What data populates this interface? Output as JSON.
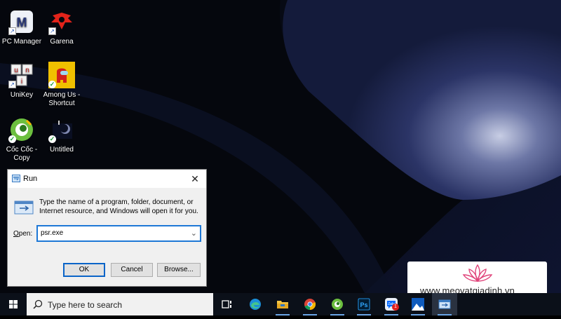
{
  "desktop": {
    "icons": [
      {
        "label": "PC Manager",
        "icon": "pc-manager-icon"
      },
      {
        "label": "Garena",
        "icon": "garena-icon"
      },
      {
        "label": "UniKey",
        "icon": "unikey-icon"
      },
      {
        "label": "Among Us - Shortcut",
        "icon": "among-us-icon"
      },
      {
        "label": "Cốc Cốc - Copy",
        "icon": "coccoc-icon"
      },
      {
        "label": "Untitled",
        "icon": "untitled-image-icon"
      }
    ]
  },
  "run_dialog": {
    "title": "Run",
    "description": "Type the name of a program, folder, document, or Internet resource, and Windows will open it for you.",
    "open_label": "Open:",
    "input_value": "psr.exe",
    "buttons": {
      "ok": "OK",
      "cancel": "Cancel",
      "browse": "Browse..."
    }
  },
  "taskbar": {
    "search_placeholder": "Type here to search",
    "apps": [
      "task-view-icon",
      "edge-icon",
      "file-explorer-icon",
      "chrome-icon",
      "coccoc-icon",
      "photoshop-icon",
      "zalo-icon",
      "photos-icon",
      "run-icon"
    ],
    "zalo_badge": "1",
    "photoshop_label": "Ps"
  },
  "watermark": {
    "text": "www.meovatgiadinh.vn"
  },
  "colors": {
    "accent": "#1e78d6",
    "taskbar": "#0b1019",
    "wallpaper": "#141b3b"
  }
}
